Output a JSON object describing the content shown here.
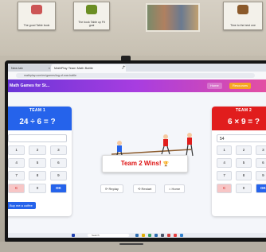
{
  "wall": {
    "posters": [
      {
        "caption": "The good Table book"
      },
      {
        "caption": "The book Table up Fit goal"
      },
      {
        "caption": "Time to the best one"
      }
    ]
  },
  "browser": {
    "tabs": [
      {
        "label": "New tab"
      },
      {
        "label": "MathPlay Team Math Battle"
      }
    ],
    "new_tab": "+",
    "close": "×",
    "url": "mathplay.com/en/games/tug-of-war-battle"
  },
  "app": {
    "title": "Math Games for St...",
    "home_btn": "Home",
    "resources_btn": "Resources"
  },
  "team1": {
    "name": "TEAM 1",
    "question": "24 ÷ 6 = ?",
    "answer": "",
    "keys": [
      "1",
      "2",
      "3",
      "4",
      "5",
      "6",
      "7",
      "8",
      "9",
      "C",
      "0",
      "OK"
    ],
    "coffee_btn": "Buy me a coffee"
  },
  "team2": {
    "name": "TEAM 2",
    "question": "6 × 9 = ?",
    "answer": "54",
    "keys": [
      "1",
      "2",
      "3",
      "4",
      "5",
      "6",
      "7",
      "8",
      "9",
      "C",
      "0",
      "OK"
    ]
  },
  "result": {
    "banner": "Team 2 Wins!",
    "trophy": "🏆"
  },
  "controls": {
    "replay": "⟳ Replay",
    "restart": "⟲ Restart",
    "home": "⌂ Home"
  },
  "taskbar": {
    "search": "Search",
    "icon_colors": [
      "#1e40af",
      "#2b6cb0",
      "#e2b007",
      "#38a169",
      "#2b6cb0",
      "#4a5568",
      "#d53f3f",
      "#e53e3e",
      "#3182ce"
    ]
  },
  "colors": {
    "team1": "#2563eb",
    "team2": "#e11d1d",
    "banner_text": "#d11111"
  }
}
